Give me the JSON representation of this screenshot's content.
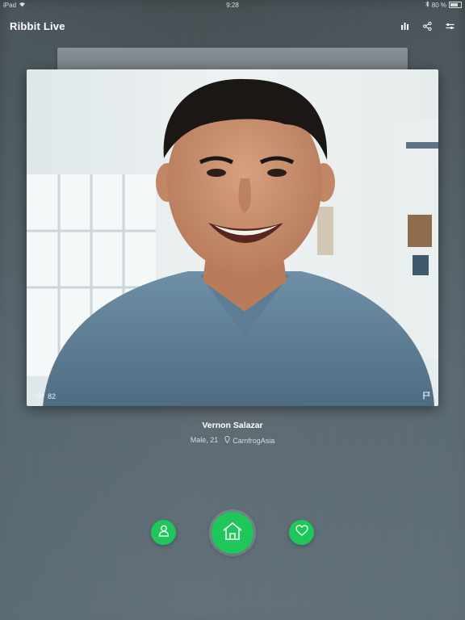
{
  "status_bar": {
    "device": "iPad",
    "time": "9:28",
    "battery": "80 %"
  },
  "app": {
    "brand": "Ribbit Live"
  },
  "topbar_icons": [
    "stats-icon",
    "share-icon",
    "filter-icon"
  ],
  "profile": {
    "name": "Vernon Salazar",
    "gender_age": "Male, 21",
    "location": "CamfrogAsia",
    "viewers": "82"
  },
  "colors": {
    "accent": "#1fc65a"
  }
}
